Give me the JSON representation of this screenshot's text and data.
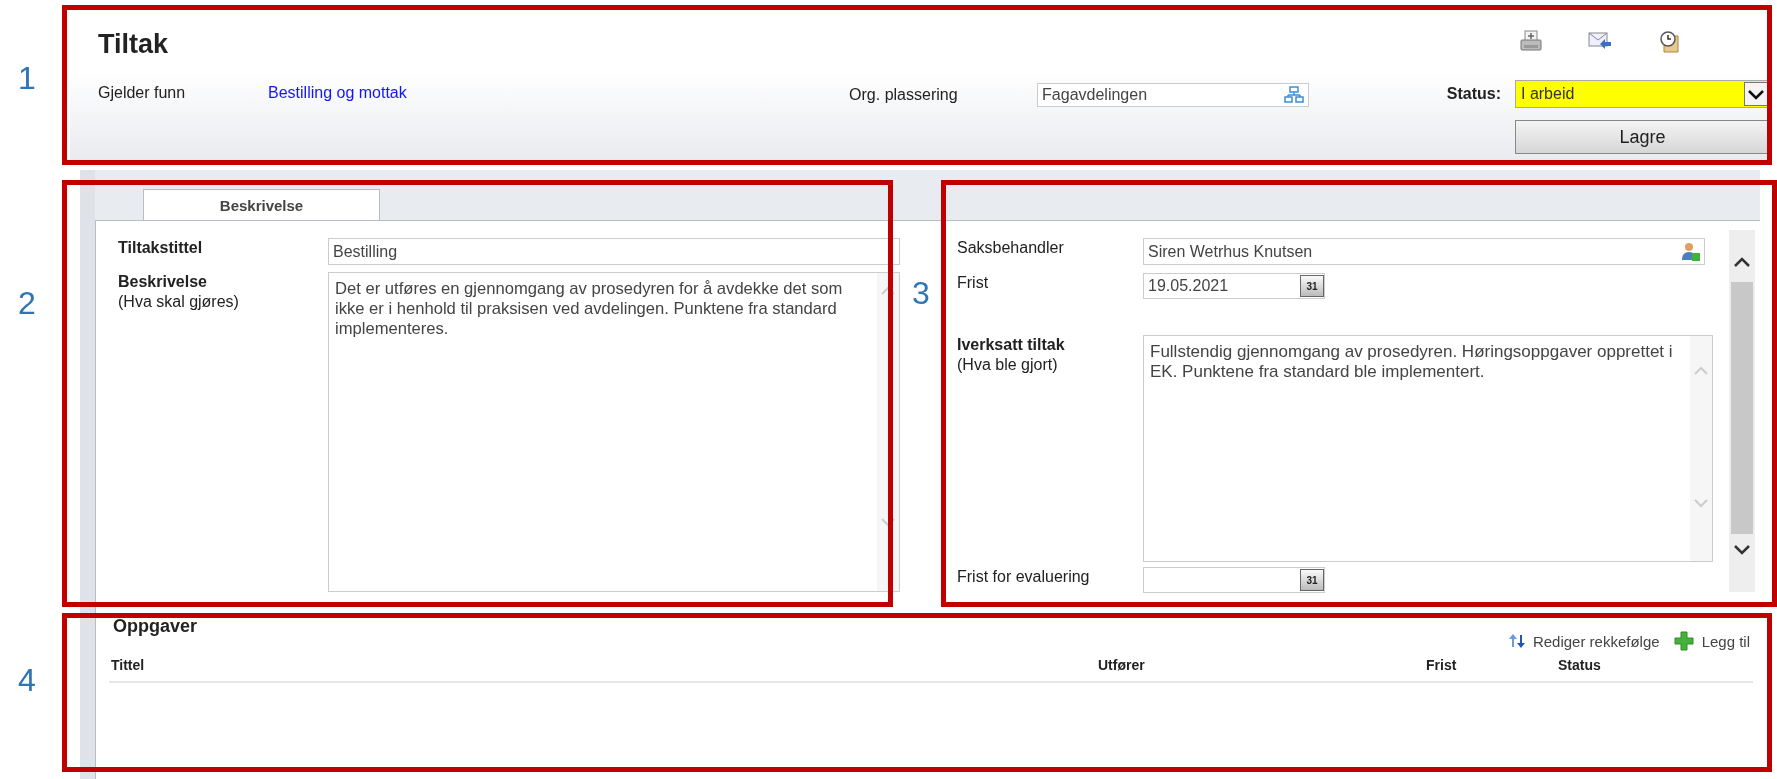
{
  "annotations": [
    {
      "label": "1"
    },
    {
      "label": "2"
    },
    {
      "label": "3"
    },
    {
      "label": "4"
    }
  ],
  "header": {
    "title": "Tiltak",
    "applies_label": "Gjelder funn",
    "applies_link": "Bestilling og mottak",
    "org_label": "Org. plassering",
    "org_value": "Fagavdelingen",
    "status_label": "Status:",
    "status_value": "I arbeid",
    "save_button": "Lagre"
  },
  "tabs": [
    {
      "label": "Beskrivelse",
      "selected": true
    }
  ],
  "left_form": {
    "title_label": "Tiltakstittel",
    "title_value": "Bestilling",
    "description_label": "Beskrivelse",
    "description_hint": "(Hva skal gjøres)",
    "description_value": "Det er utføres en gjennomgang av prosedyren for å avdekke det som ikke er i henhold til praksisen ved avdelingen. Punktene fra standard implementeres."
  },
  "right_form": {
    "handler_label": "Saksbehandler",
    "handler_value": "Siren Wetrhus Knutsen",
    "deadline_label": "Frist",
    "deadline_value": "19.05.2021",
    "deadline_calendar": "31",
    "done_label": "Iverksatt tiltak",
    "done_hint": "(Hva ble gjort)",
    "done_value": "Fullstendig gjennomgang av prosedyren. Høringsoppgaver opprettet i EK. Punktene fra standard ble implementert.",
    "evaluation_label": "Frist for evaluering",
    "evaluation_calendar": "31"
  },
  "tasks": {
    "title": "Oppgaver",
    "actions": [
      {
        "kind": "reorder",
        "label": "Rediger rekkefølge"
      },
      {
        "kind": "add",
        "label": "Legg til"
      }
    ],
    "columns": [
      "Tittel",
      "Utfører",
      "Frist",
      "Status"
    ]
  }
}
